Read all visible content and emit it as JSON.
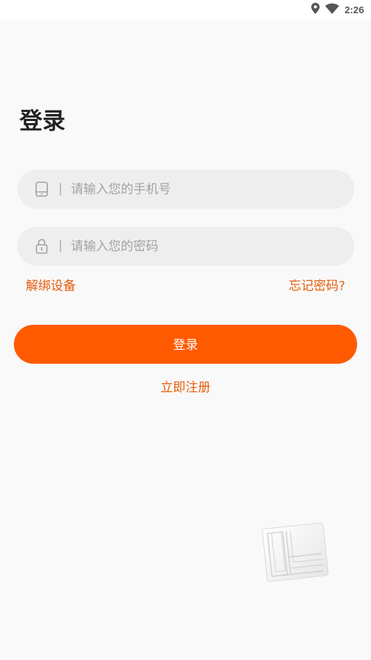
{
  "status_bar": {
    "time": "2:26",
    "icons": [
      "location-icon",
      "wifi-icon"
    ]
  },
  "login_form": {
    "title": "登录",
    "phone_placeholder": "请输入您的手机号",
    "password_placeholder": "请输入您的密码",
    "unbind_device_label": "解绑设备",
    "forgot_password_label": "忘记密码?",
    "login_button_label": "登录",
    "register_label": "立即注册"
  },
  "colors": {
    "accent": "#ff5a00",
    "link": "#e85c0d",
    "background": "#f9f9f9",
    "input_background": "#eeeeee"
  }
}
